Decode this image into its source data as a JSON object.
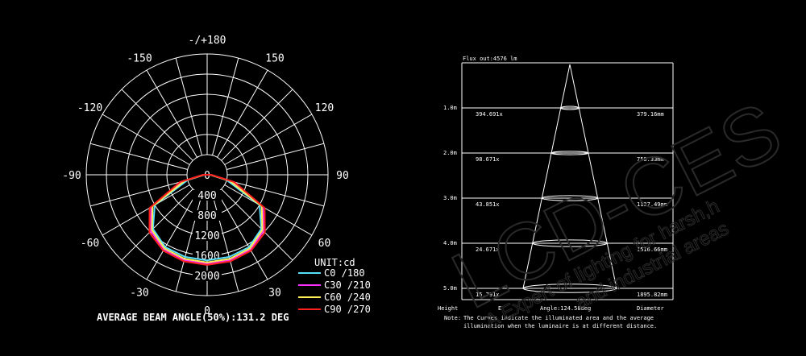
{
  "polar": {
    "angle_labels": [
      {
        "text": "-/+180",
        "deg": 180
      },
      {
        "text": "-150",
        "deg": -150
      },
      {
        "text": "150",
        "deg": 150
      },
      {
        "text": "-120",
        "deg": -120
      },
      {
        "text": "120",
        "deg": 120
      },
      {
        "text": "-90",
        "deg": -90
      },
      {
        "text": "90",
        "deg": 90
      },
      {
        "text": "-60",
        "deg": -60
      },
      {
        "text": "60",
        "deg": 60
      },
      {
        "text": "-30",
        "deg": -30
      },
      {
        "text": "30",
        "deg": 30
      },
      {
        "text": "0",
        "deg": 0
      }
    ],
    "rings": [
      {
        "value": 0,
        "text": "0"
      },
      {
        "value": 400,
        "text": "400"
      },
      {
        "value": 800,
        "text": "800"
      },
      {
        "value": 1200,
        "text": "1200"
      },
      {
        "value": 1600,
        "text": "1600"
      },
      {
        "value": 2000,
        "text": "2000"
      }
    ],
    "unit_label": "UNIT:cd",
    "beam_text": "AVERAGE BEAM ANGLE(50%):131.2 DEG"
  },
  "chart_data": [
    {
      "type": "line",
      "subtype": "polar",
      "rlim": [
        0,
        2400
      ],
      "angle_step_deg": 15,
      "legend_position": "bottom-right",
      "series": [
        {
          "name": "C0  /180",
          "color": "#55e0ff",
          "angles": [
            -180,
            -150,
            -120,
            -105,
            -90,
            -75,
            -60,
            -45,
            -30,
            -15,
            0,
            15,
            30,
            45,
            60,
            75,
            90,
            105,
            120,
            150,
            180
          ],
          "values": [
            0,
            0,
            0,
            0,
            60,
            400,
            1200,
            1520,
            1660,
            1690,
            1700,
            1690,
            1660,
            1520,
            1200,
            400,
            60,
            0,
            0,
            0,
            0
          ]
        },
        {
          "name": "C30 /210",
          "color": "#ff30ff",
          "angles": [
            -180,
            -150,
            -120,
            -105,
            -90,
            -75,
            -60,
            -45,
            -30,
            -15,
            0,
            15,
            30,
            45,
            60,
            75,
            90,
            105,
            120,
            150,
            180
          ],
          "values": [
            0,
            0,
            0,
            0,
            70,
            500,
            1280,
            1580,
            1720,
            1760,
            1770,
            1760,
            1720,
            1580,
            1280,
            500,
            70,
            0,
            0,
            0,
            0
          ]
        },
        {
          "name": "C60 /240",
          "color": "#ffee55",
          "angles": [
            -180,
            -150,
            -120,
            -105,
            -90,
            -75,
            -60,
            -45,
            -30,
            -15,
            0,
            15,
            30,
            45,
            60,
            75,
            90,
            105,
            120,
            150,
            180
          ],
          "values": [
            0,
            0,
            0,
            0,
            65,
            460,
            1250,
            1550,
            1690,
            1730,
            1740,
            1730,
            1690,
            1550,
            1250,
            460,
            65,
            0,
            0,
            0,
            0
          ]
        },
        {
          "name": "C90 /270",
          "color": "#ff2020",
          "angles": [
            -180,
            -150,
            -120,
            -105,
            -90,
            -75,
            -60,
            -45,
            -30,
            -15,
            0,
            15,
            30,
            45,
            60,
            75,
            90,
            105,
            120,
            150,
            180
          ],
          "values": [
            0,
            0,
            0,
            0,
            80,
            560,
            1320,
            1620,
            1740,
            1780,
            1790,
            1780,
            1740,
            1620,
            1320,
            560,
            80,
            0,
            0,
            0,
            0
          ]
        }
      ]
    },
    {
      "type": "table",
      "title": "Flux out:4576 lm",
      "beam_label": "Angle:124.58deg",
      "columns": [
        "Height",
        "E",
        "Diameter"
      ],
      "rows": [
        {
          "height": "1.0m",
          "illuminance": "394.691x",
          "diameter": "379.16mm"
        },
        {
          "height": "2.0m",
          "illuminance": "98.671x",
          "diameter": "758.33mm"
        },
        {
          "height": "3.0m",
          "illuminance": "43.851x",
          "diameter": "1137.49mm"
        },
        {
          "height": "4.0m",
          "illuminance": "24.671x",
          "diameter": "1516.66mm"
        },
        {
          "height": "5.0m",
          "illuminance": "15.791x",
          "diameter": "1895.82mm"
        }
      ],
      "note_prefix": "Note:",
      "note_line1": "The Curves indicate the illuminated area and the average",
      "note_line2": "illumination when the luminaire is at different distance."
    }
  ],
  "watermark": {
    "logo": "LCD-CES",
    "line1": "A Expert of lighting for harsh,h",
    "line2": "and industrial areas"
  }
}
